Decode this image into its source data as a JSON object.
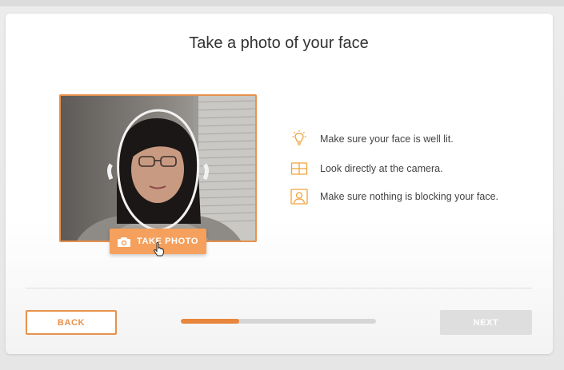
{
  "page": {
    "title": "Take a photo of your face"
  },
  "camera": {
    "take_photo_label": "TAKE PHOTO",
    "button_icon": "camera-icon",
    "accent_color": "#e8914c",
    "button_color": "#f5a05c"
  },
  "tips": [
    {
      "icon": "lightbulb-icon",
      "text": "Make sure your face is well lit."
    },
    {
      "icon": "camera-grid-icon",
      "text": "Look directly at the camera."
    },
    {
      "icon": "face-portrait-icon",
      "text": "Make sure nothing is blocking your face."
    }
  ],
  "footer": {
    "back_label": "BACK",
    "next_label": "NEXT",
    "progress_fraction": 0.3,
    "next_enabled": false
  }
}
